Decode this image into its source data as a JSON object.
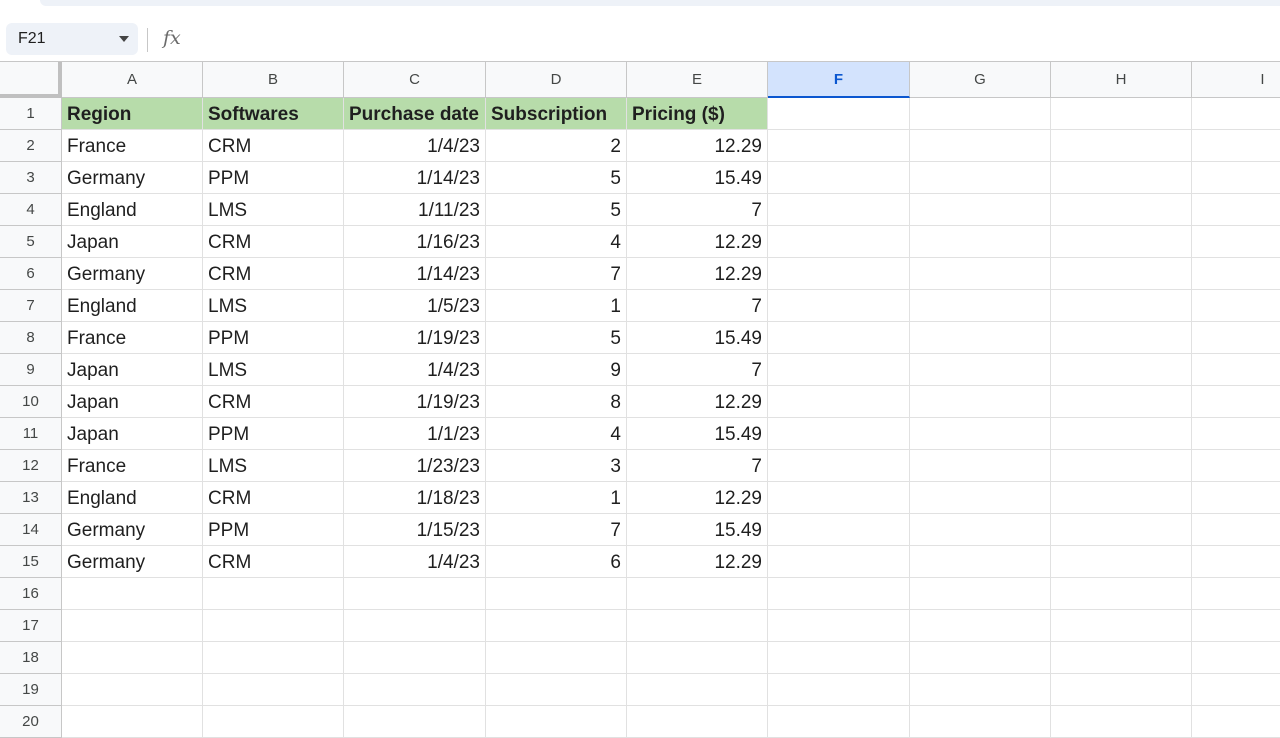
{
  "formula_bar": {
    "name_box": "F21",
    "fx_label": "fx",
    "formula": ""
  },
  "columns": [
    "A",
    "B",
    "C",
    "D",
    "E",
    "F",
    "G",
    "H",
    "I"
  ],
  "selected_column": "F",
  "row_numbers": [
    "1",
    "2",
    "3",
    "4",
    "5",
    "6",
    "7",
    "8",
    "9",
    "10",
    "11",
    "12",
    "13",
    "14",
    "15",
    "16",
    "17",
    "18",
    "19",
    "20"
  ],
  "table": {
    "headers": [
      "Region",
      "Softwares",
      "Purchase date",
      "Subscription",
      "Pricing ($)"
    ],
    "rows": [
      [
        "France",
        "CRM",
        "1/4/23",
        "2",
        "12.29"
      ],
      [
        "Germany",
        "PPM",
        "1/14/23",
        "5",
        "15.49"
      ],
      [
        "England",
        "LMS",
        "1/11/23",
        "5",
        "7"
      ],
      [
        "Japan",
        "CRM",
        "1/16/23",
        "4",
        "12.29"
      ],
      [
        "Germany",
        "CRM",
        "1/14/23",
        "7",
        "12.29"
      ],
      [
        "England",
        "LMS",
        "1/5/23",
        "1",
        "7"
      ],
      [
        "France",
        "PPM",
        "1/19/23",
        "5",
        "15.49"
      ],
      [
        "Japan",
        "LMS",
        "1/4/23",
        "9",
        "7"
      ],
      [
        "Japan",
        "CRM",
        "1/19/23",
        "8",
        "12.29"
      ],
      [
        "Japan",
        "PPM",
        "1/1/23",
        "4",
        "15.49"
      ],
      [
        "France",
        "LMS",
        "1/23/23",
        "3",
        "7"
      ],
      [
        "England",
        "CRM",
        "1/18/23",
        "1",
        "12.29"
      ],
      [
        "Germany",
        "PPM",
        "1/15/23",
        "7",
        "15.49"
      ],
      [
        "Germany",
        "CRM",
        "1/4/23",
        "6",
        "12.29"
      ]
    ]
  },
  "colors": {
    "header_fill": "#b7dcaa",
    "selected_column_fill": "#d3e3fd",
    "selection_accent": "#0b57d0"
  }
}
